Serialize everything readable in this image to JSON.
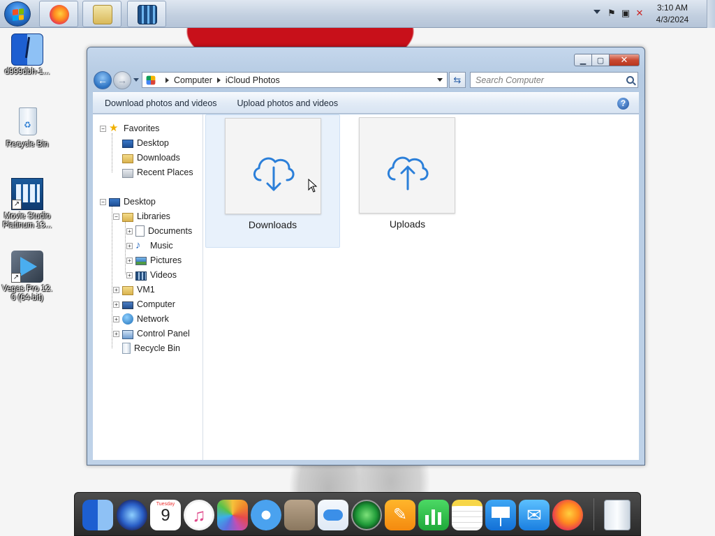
{
  "colors": {
    "accent": "#2b7fd9",
    "window_frame": "#b6cbe3",
    "selection": "#e8f1fb",
    "dock": "#2a2a2a"
  },
  "taskbar": {
    "clock_time": "3:10 AM",
    "clock_date": "4/3/2024",
    "pinned": [
      {
        "name": "firefox-icon"
      },
      {
        "name": "windows-explorer-icon"
      },
      {
        "name": "movie-studio-icon"
      }
    ]
  },
  "desktop": {
    "icons": [
      {
        "label": "d999dbh-1...",
        "icon": "finder-icon"
      },
      {
        "label": "Recycle Bin",
        "icon": "recycle-bin-icon"
      },
      {
        "label": "Movie Studio Platinum 13...",
        "icon": "movie-studio-icon"
      },
      {
        "label": "Vegas Pro 12.0 (64-bit)",
        "icon": "vegas-pro-icon"
      }
    ]
  },
  "window": {
    "breadcrumb": [
      "Computer",
      "iCloud Photos"
    ],
    "search_placeholder": "Search Computer",
    "commands": [
      "Download photos and videos",
      "Upload photos and videos"
    ],
    "help_label": "?",
    "nav_tree": [
      {
        "label": "Favorites",
        "level": 0,
        "expander": "−",
        "icon": "star-icon"
      },
      {
        "label": "Desktop",
        "level": 1,
        "expander": "",
        "icon": "desktop-icon"
      },
      {
        "label": "Downloads",
        "level": 1,
        "expander": "",
        "icon": "downloads-folder-icon"
      },
      {
        "label": "Recent Places",
        "level": 1,
        "expander": "",
        "icon": "recent-places-icon"
      },
      {
        "label": "Desktop",
        "level": 0,
        "expander": "−",
        "icon": "desktop-icon"
      },
      {
        "label": "Libraries",
        "level": 1,
        "expander": "−",
        "icon": "libraries-icon"
      },
      {
        "label": "Documents",
        "level": 2,
        "expander": "+",
        "icon": "documents-icon"
      },
      {
        "label": "Music",
        "level": 2,
        "expander": "+",
        "icon": "music-icon"
      },
      {
        "label": "Pictures",
        "level": 2,
        "expander": "+",
        "icon": "pictures-icon"
      },
      {
        "label": "Videos",
        "level": 2,
        "expander": "+",
        "icon": "videos-icon"
      },
      {
        "label": "VM1",
        "level": 1,
        "expander": "+",
        "icon": "user-folder-icon"
      },
      {
        "label": "Computer",
        "level": 1,
        "expander": "+",
        "icon": "computer-icon"
      },
      {
        "label": "Network",
        "level": 1,
        "expander": "+",
        "icon": "network-icon"
      },
      {
        "label": "Control Panel",
        "level": 1,
        "expander": "+",
        "icon": "control-panel-icon"
      },
      {
        "label": "Recycle Bin",
        "level": 1,
        "expander": "",
        "icon": "recycle-bin-icon"
      }
    ],
    "files": [
      {
        "label": "Downloads",
        "icon": "cloud-download-icon",
        "selected": true
      },
      {
        "label": "Uploads",
        "icon": "cloud-upload-icon",
        "selected": false
      }
    ]
  },
  "dock": {
    "calendar_day": "9",
    "calendar_weekday": "Tuesday",
    "apps": [
      "finder-icon",
      "siri-icon",
      "calendar-icon",
      "itunes-icon",
      "photos-icon",
      "safari-icon",
      "contacts-icon",
      "icloud-drive-icon",
      "find-my-icon",
      "pages-icon",
      "numbers-icon",
      "notes-icon",
      "keynote-icon",
      "mail-icon",
      "firefox-icon",
      "trash-icon"
    ]
  }
}
